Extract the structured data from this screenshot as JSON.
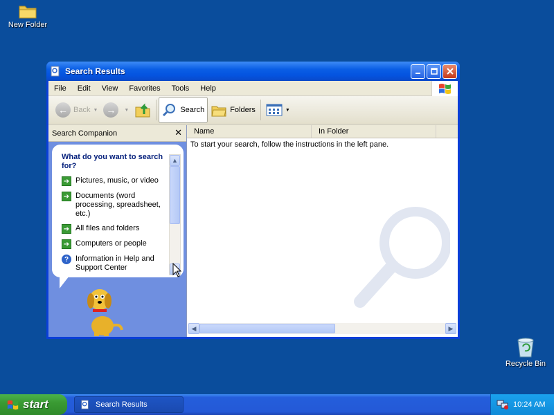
{
  "desktop": {
    "icons": [
      {
        "label": "New Folder",
        "icon": "folder-icon"
      },
      {
        "label": "Recycle Bin",
        "icon": "recycle-bin-icon"
      }
    ]
  },
  "window": {
    "title": "Search Results",
    "menu": [
      "File",
      "Edit",
      "View",
      "Favorites",
      "Tools",
      "Help"
    ],
    "toolbar": {
      "back_label": "Back",
      "search_label": "Search",
      "folders_label": "Folders"
    },
    "left_pane": {
      "header": "Search Companion",
      "question": "What do you want to search for?",
      "options": [
        "Pictures, music, or video",
        "Documents (word processing, spreadsheet, etc.)",
        "All files and folders",
        "Computers or people",
        "Information in Help and Support Center"
      ]
    },
    "right_pane": {
      "columns": [
        "Name",
        "In Folder"
      ],
      "message": "To start your search, follow the instructions in the left pane."
    }
  },
  "taskbar": {
    "start_label": "start",
    "tasks": [
      "Search Results"
    ],
    "clock": "10:24 AM"
  },
  "colors": {
    "desktop": "#0a4d9c",
    "titlebar": "#0a5ee5",
    "start": "#3a9a33",
    "taskbar": "#245edb"
  }
}
